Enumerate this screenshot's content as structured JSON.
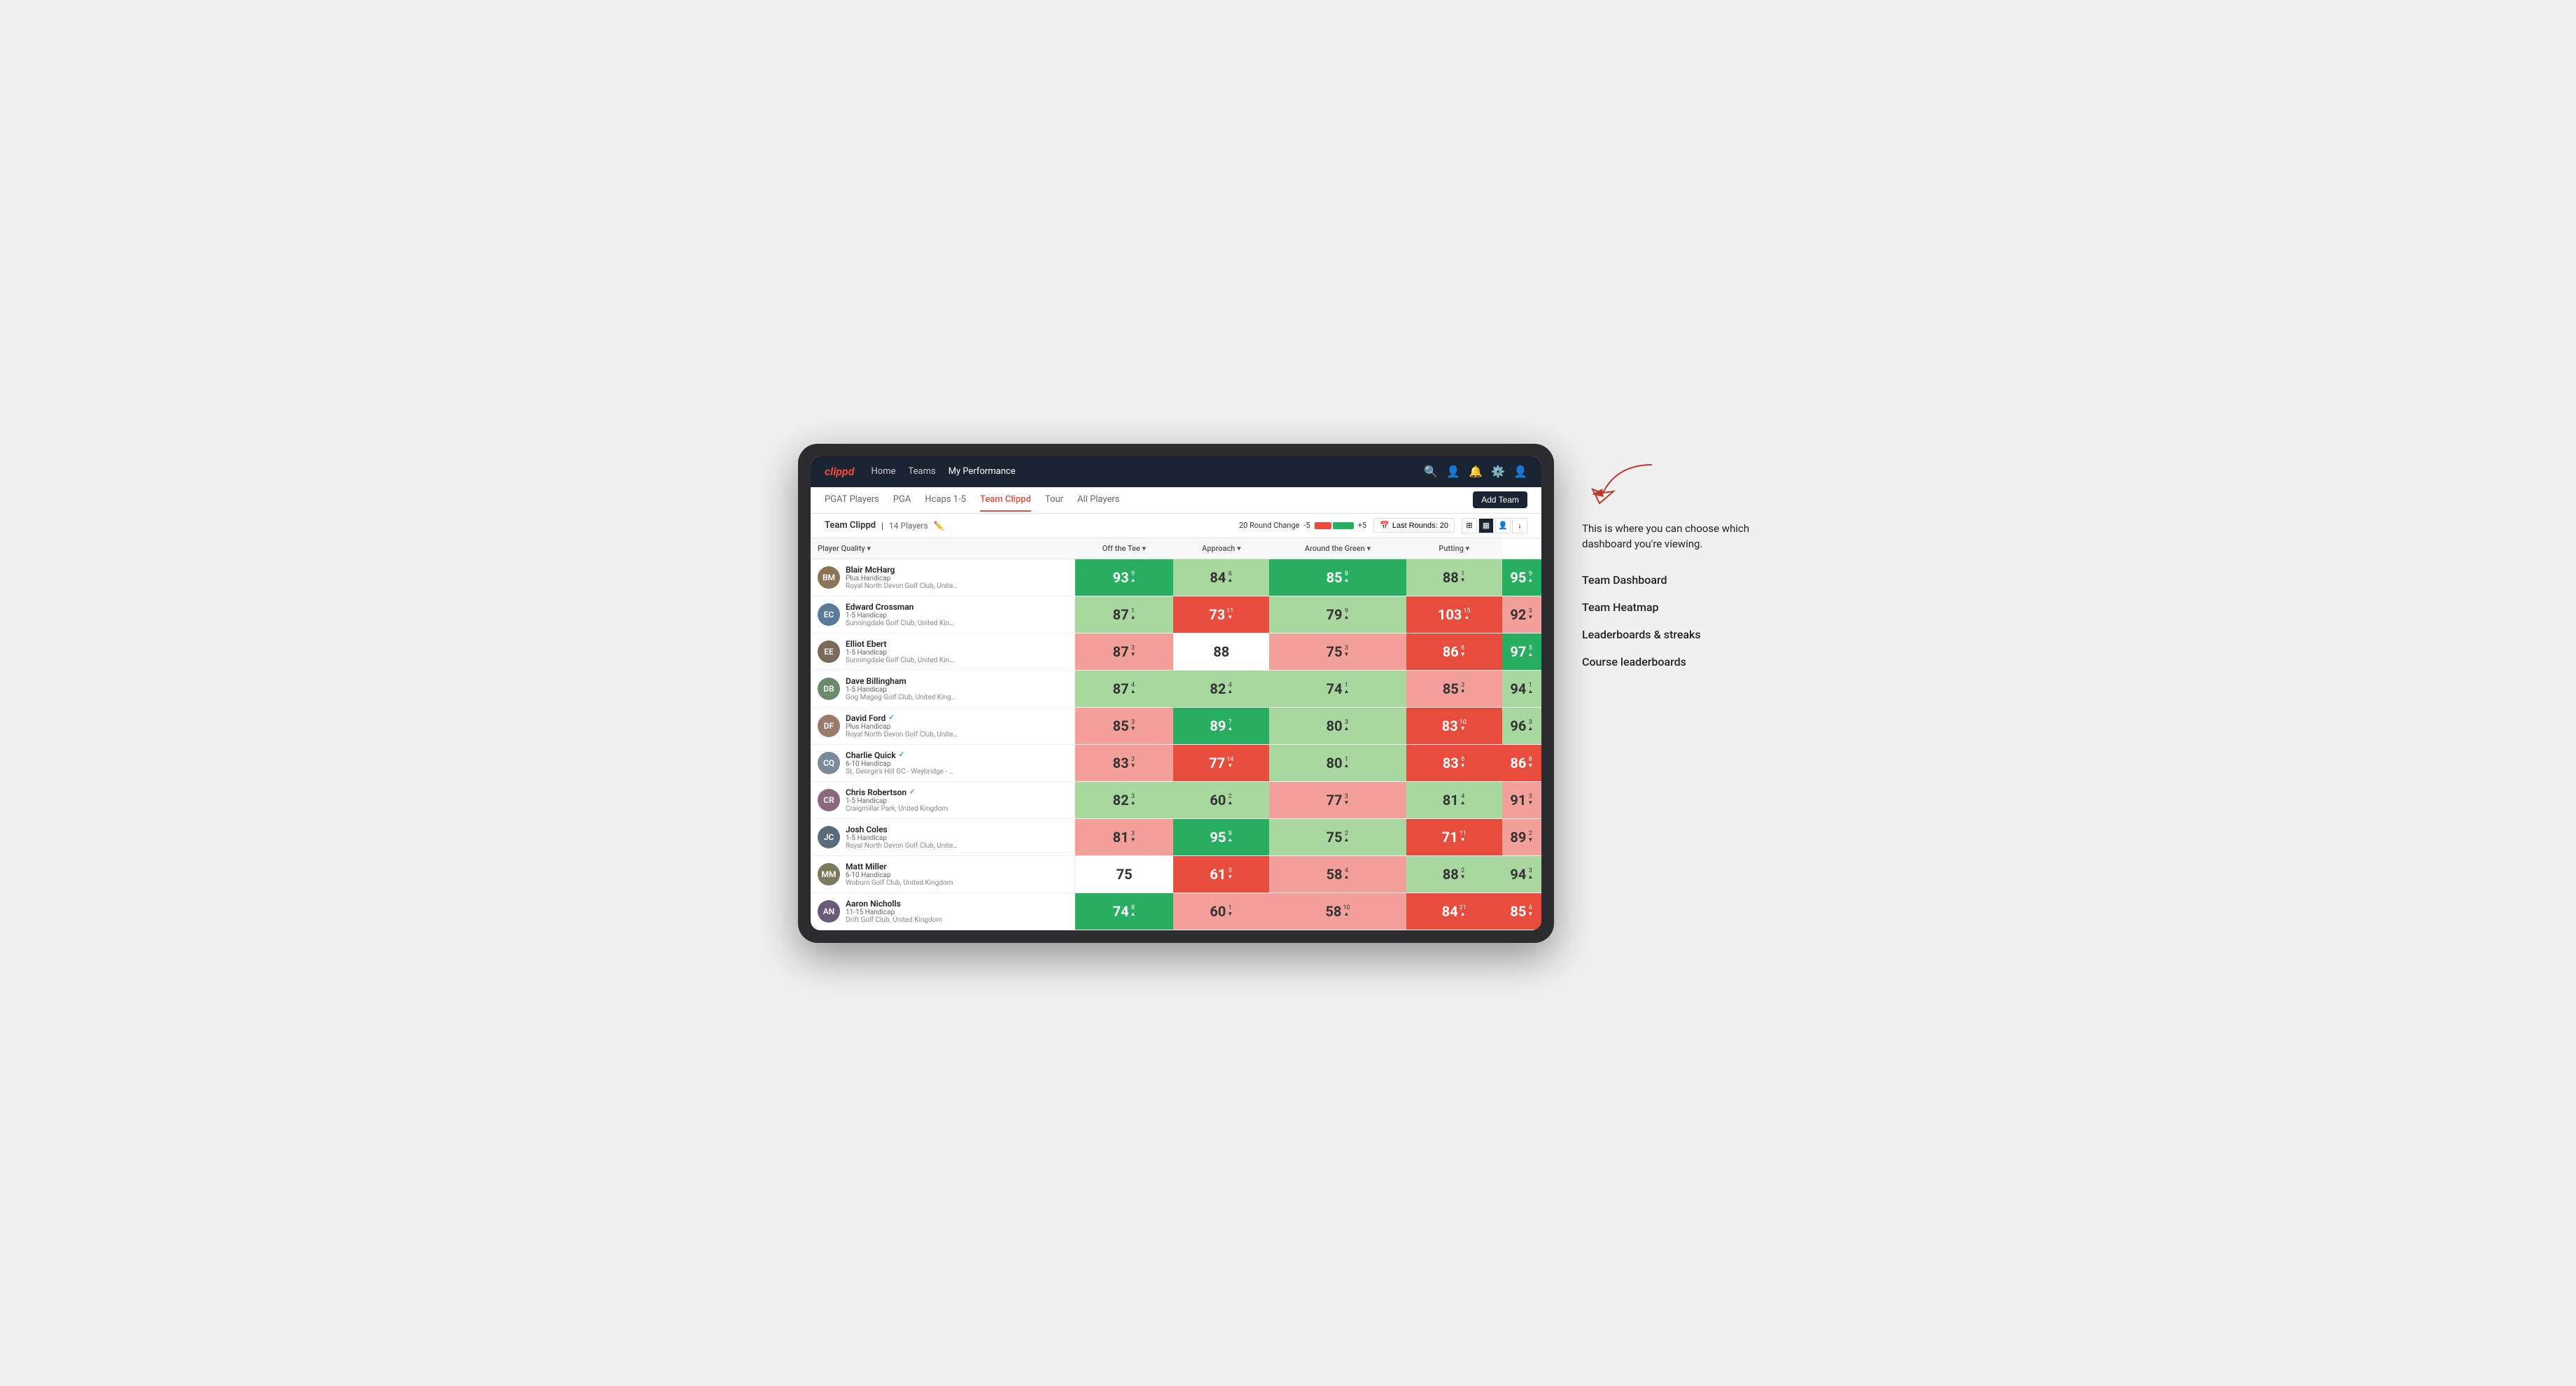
{
  "app": {
    "logo": "clippd",
    "nav_links": [
      "Home",
      "Teams",
      "My Performance"
    ],
    "sub_nav_links": [
      "PGAT Players",
      "PGA",
      "Hcaps 1-5",
      "Team Clippd",
      "Tour",
      "All Players"
    ],
    "active_sub_nav": "Team Clippd",
    "add_team_label": "Add Team"
  },
  "team_header": {
    "name": "Team Clippd",
    "count": "14 Players",
    "round_change_label": "20 Round Change",
    "minus_label": "-5",
    "plus_label": "+5",
    "last_rounds_label": "Last Rounds: 20"
  },
  "table": {
    "columns": [
      "Player Quality ▾",
      "Off the Tee ▾",
      "Approach ▾",
      "Around the Green ▾",
      "Putting ▾"
    ],
    "players": [
      {
        "name": "Blair McHarg",
        "handicap": "Plus Handicap",
        "club": "Royal North Devon Golf Club, United Kingdom",
        "initials": "BM",
        "avatar_color": "#8B7355",
        "scores": [
          {
            "value": 93,
            "delta": 9,
            "dir": "up",
            "bg": "green-dark"
          },
          {
            "value": 84,
            "delta": 6,
            "dir": "up",
            "bg": "green-light"
          },
          {
            "value": 85,
            "delta": 8,
            "dir": "up",
            "bg": "green-dark"
          },
          {
            "value": 88,
            "delta": 1,
            "dir": "down",
            "bg": "green-light"
          },
          {
            "value": 95,
            "delta": 9,
            "dir": "up",
            "bg": "green-dark"
          }
        ]
      },
      {
        "name": "Edward Crossman",
        "handicap": "1-5 Handicap",
        "club": "Sunningdale Golf Club, United Kingdom",
        "initials": "EC",
        "avatar_color": "#5a7a9a",
        "scores": [
          {
            "value": 87,
            "delta": 1,
            "dir": "up",
            "bg": "green-light"
          },
          {
            "value": 73,
            "delta": 11,
            "dir": "down",
            "bg": "red-dark"
          },
          {
            "value": 79,
            "delta": 9,
            "dir": "up",
            "bg": "green-light"
          },
          {
            "value": 103,
            "delta": 15,
            "dir": "up",
            "bg": "red-dark"
          },
          {
            "value": 92,
            "delta": 3,
            "dir": "down",
            "bg": "red-light"
          }
        ]
      },
      {
        "name": "Elliot Ebert",
        "handicap": "1-5 Handicap",
        "club": "Sunningdale Golf Club, United Kingdom",
        "initials": "EE",
        "avatar_color": "#7a6a5a",
        "scores": [
          {
            "value": 87,
            "delta": 3,
            "dir": "down",
            "bg": "red-light"
          },
          {
            "value": 88,
            "delta": null,
            "dir": null,
            "bg": "white"
          },
          {
            "value": 75,
            "delta": 3,
            "dir": "down",
            "bg": "red-light"
          },
          {
            "value": 86,
            "delta": 6,
            "dir": "down",
            "bg": "red-dark"
          },
          {
            "value": 97,
            "delta": 5,
            "dir": "up",
            "bg": "green-dark"
          }
        ]
      },
      {
        "name": "Dave Billingham",
        "handicap": "1-5 Handicap",
        "club": "Gog Magog Golf Club, United Kingdom",
        "initials": "DB",
        "avatar_color": "#6a8a6a",
        "scores": [
          {
            "value": 87,
            "delta": 4,
            "dir": "up",
            "bg": "green-light"
          },
          {
            "value": 82,
            "delta": 4,
            "dir": "up",
            "bg": "green-light"
          },
          {
            "value": 74,
            "delta": 1,
            "dir": "up",
            "bg": "green-light"
          },
          {
            "value": 85,
            "delta": 3,
            "dir": "down",
            "bg": "red-light"
          },
          {
            "value": 94,
            "delta": 1,
            "dir": "up",
            "bg": "green-light"
          }
        ]
      },
      {
        "name": "David Ford",
        "handicap": "Plus Handicap",
        "club": "Royal North Devon Golf Club, United Kingdom",
        "initials": "DF",
        "verified": true,
        "avatar_color": "#9a7a6a",
        "scores": [
          {
            "value": 85,
            "delta": 3,
            "dir": "down",
            "bg": "red-light"
          },
          {
            "value": 89,
            "delta": 7,
            "dir": "up",
            "bg": "green-dark"
          },
          {
            "value": 80,
            "delta": 3,
            "dir": "up",
            "bg": "green-light"
          },
          {
            "value": 83,
            "delta": 10,
            "dir": "down",
            "bg": "red-dark"
          },
          {
            "value": 96,
            "delta": 3,
            "dir": "up",
            "bg": "green-light"
          }
        ]
      },
      {
        "name": "Charlie Quick",
        "handicap": "6-10 Handicap",
        "club": "St. George's Hill GC - Weybridge - Surrey, Uni...",
        "initials": "CQ",
        "verified": true,
        "avatar_color": "#7a8a9a",
        "scores": [
          {
            "value": 83,
            "delta": 3,
            "dir": "down",
            "bg": "red-light"
          },
          {
            "value": 77,
            "delta": 14,
            "dir": "down",
            "bg": "red-dark"
          },
          {
            "value": 80,
            "delta": 1,
            "dir": "up",
            "bg": "green-light"
          },
          {
            "value": 83,
            "delta": 6,
            "dir": "down",
            "bg": "red-dark"
          },
          {
            "value": 86,
            "delta": 8,
            "dir": "down",
            "bg": "red-dark"
          }
        ]
      },
      {
        "name": "Chris Robertson",
        "handicap": "1-5 Handicap",
        "club": "Craigmillar Park, United Kingdom",
        "initials": "CR",
        "verified": true,
        "avatar_color": "#8a6a7a",
        "scores": [
          {
            "value": 82,
            "delta": 3,
            "dir": "up",
            "bg": "green-light"
          },
          {
            "value": 60,
            "delta": 2,
            "dir": "up",
            "bg": "green-light"
          },
          {
            "value": 77,
            "delta": 3,
            "dir": "down",
            "bg": "red-light"
          },
          {
            "value": 81,
            "delta": 4,
            "dir": "up",
            "bg": "green-light"
          },
          {
            "value": 91,
            "delta": 3,
            "dir": "down",
            "bg": "red-light"
          }
        ]
      },
      {
        "name": "Josh Coles",
        "handicap": "1-5 Handicap",
        "club": "Royal North Devon Golf Club, United Kingdom",
        "initials": "JC",
        "avatar_color": "#5a6a7a",
        "scores": [
          {
            "value": 81,
            "delta": 3,
            "dir": "down",
            "bg": "red-light"
          },
          {
            "value": 95,
            "delta": 8,
            "dir": "up",
            "bg": "green-dark"
          },
          {
            "value": 75,
            "delta": 2,
            "dir": "up",
            "bg": "green-light"
          },
          {
            "value": 71,
            "delta": 11,
            "dir": "down",
            "bg": "red-dark"
          },
          {
            "value": 89,
            "delta": 2,
            "dir": "down",
            "bg": "red-light"
          }
        ]
      },
      {
        "name": "Matt Miller",
        "handicap": "6-10 Handicap",
        "club": "Woburn Golf Club, United Kingdom",
        "initials": "MM",
        "avatar_color": "#7a7a5a",
        "scores": [
          {
            "value": 75,
            "delta": null,
            "dir": null,
            "bg": "white"
          },
          {
            "value": 61,
            "delta": 3,
            "dir": "down",
            "bg": "red-dark"
          },
          {
            "value": 58,
            "delta": 4,
            "dir": "up",
            "bg": "red-light"
          },
          {
            "value": 88,
            "delta": 2,
            "dir": "down",
            "bg": "green-light"
          },
          {
            "value": 94,
            "delta": 3,
            "dir": "up",
            "bg": "green-light"
          }
        ]
      },
      {
        "name": "Aaron Nicholls",
        "handicap": "11-15 Handicap",
        "club": "Drift Golf Club, United Kingdom",
        "initials": "AN",
        "avatar_color": "#6a5a7a",
        "scores": [
          {
            "value": 74,
            "delta": 8,
            "dir": "up",
            "bg": "green-dark"
          },
          {
            "value": 60,
            "delta": 1,
            "dir": "down",
            "bg": "red-light"
          },
          {
            "value": 58,
            "delta": 10,
            "dir": "up",
            "bg": "red-light"
          },
          {
            "value": 84,
            "delta": 21,
            "dir": "up",
            "bg": "red-dark"
          },
          {
            "value": 85,
            "delta": 4,
            "dir": "down",
            "bg": "red-dark"
          }
        ]
      }
    ]
  },
  "annotations": {
    "intro_text": "This is where you can choose which dashboard you're viewing.",
    "items": [
      "Team Dashboard",
      "Team Heatmap",
      "Leaderboards & streaks",
      "Course leaderboards"
    ]
  }
}
